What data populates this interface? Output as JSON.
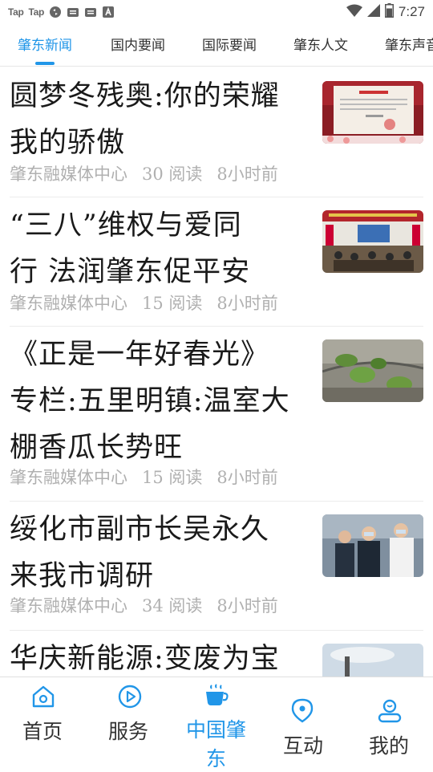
{
  "status_bar": {
    "apps": [
      "Tap",
      "Tap"
    ],
    "time": "7:27",
    "battery_level": 0.7
  },
  "tabs": [
    {
      "label": "肇东新闻",
      "active": true
    },
    {
      "label": "国内要闻",
      "active": false
    },
    {
      "label": "国际要闻",
      "active": false
    },
    {
      "label": "肇东人文",
      "active": false
    },
    {
      "label": "肇东声音",
      "active": false
    }
  ],
  "news": [
    {
      "title_lines": [
        "圆梦冬残奥:你的荣耀",
        "我的骄傲"
      ],
      "source": "肇东融媒体中心",
      "reads": "30 阅读",
      "time": "8小时前",
      "thumb": "award-certificate"
    },
    {
      "title_lines": [
        "“三八”维权与爱同",
        "行 法润肇东促平安"
      ],
      "source": "肇东融媒体中心",
      "reads": "15 阅读",
      "time": "8小时前",
      "thumb": "meeting-hall"
    },
    {
      "title_lines": [
        "《正是一年好春光》",
        "专栏:五里明镇:温室大",
        "棚香瓜长势旺"
      ],
      "source": "肇东融媒体中心",
      "reads": "15 阅读",
      "time": "8小时前",
      "thumb": "greenhouse-seedling"
    },
    {
      "title_lines": [
        "绥化市副市长吴永久",
        "来我市调研"
      ],
      "source": "肇东融媒体中心",
      "reads": "34 阅读",
      "time": "8小时前",
      "thumb": "officials-visit"
    },
    {
      "title_lines": [
        "华庆新能源:变废为宝"
      ],
      "thumb": "factory-smokestack"
    }
  ],
  "bottom_nav": [
    {
      "label": "首页",
      "icon": "home-icon",
      "active": false
    },
    {
      "label": "服务",
      "icon": "play-circle-icon",
      "active": false
    },
    {
      "label_lines": [
        "中国肇",
        "东"
      ],
      "icon": "coffee-cup-icon",
      "active": true
    },
    {
      "label": "互动",
      "icon": "location-pin-icon",
      "active": false
    },
    {
      "label": "我的",
      "icon": "user-icon",
      "active": false
    }
  ],
  "colors": {
    "accent": "#2196e8",
    "meta": "#b0b0b0",
    "title": "#1a1a1a"
  }
}
